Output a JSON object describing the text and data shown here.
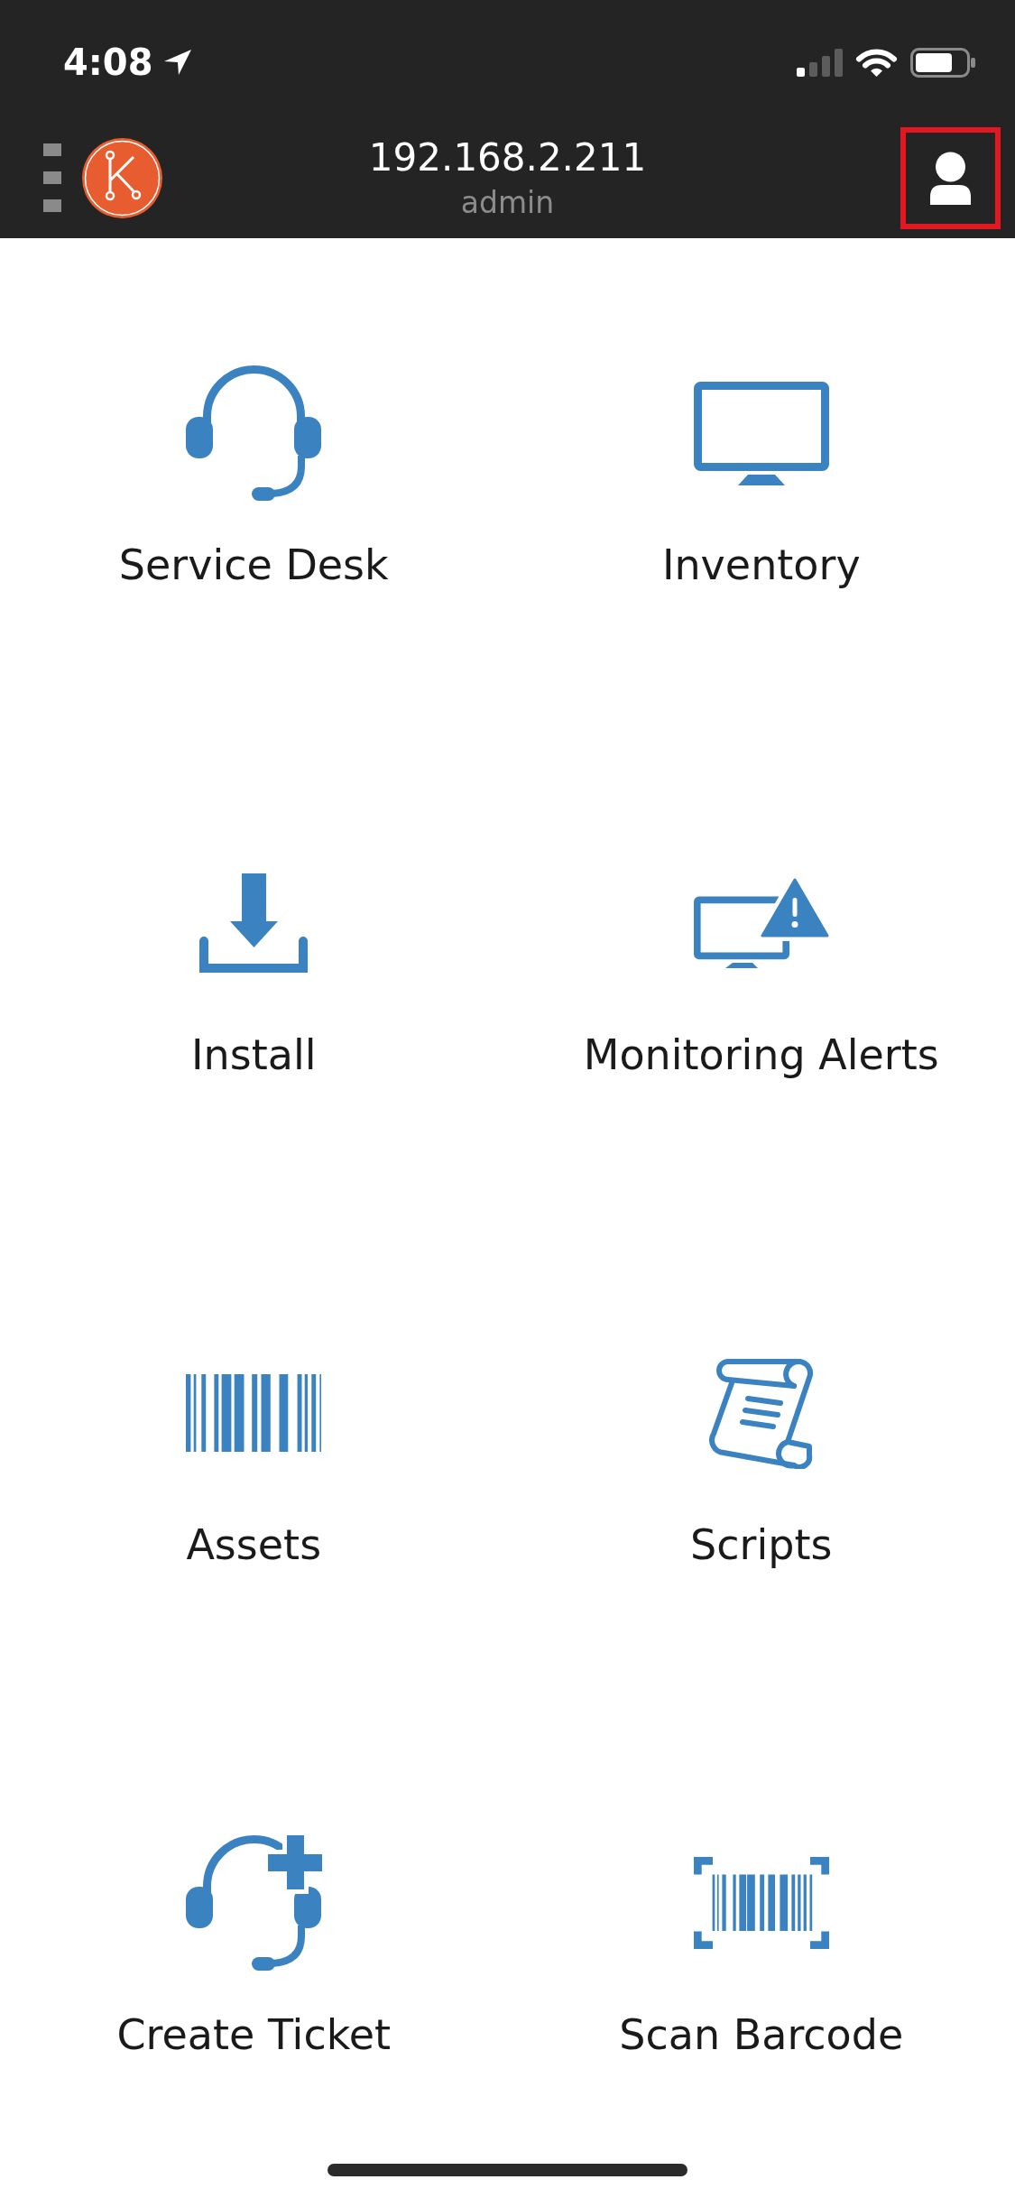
{
  "status_bar": {
    "time": "4:08"
  },
  "header": {
    "title": "192.168.2.211",
    "subtitle": "admin",
    "profile_button": {
      "highlighted": true
    }
  },
  "menu": [
    {
      "label": "Service Desk",
      "kind": "headset"
    },
    {
      "label": "Inventory",
      "kind": "monitor"
    },
    {
      "label": "Install",
      "kind": "download"
    },
    {
      "label": "Monitoring Alerts",
      "kind": "monitor-alert"
    },
    {
      "label": "Assets",
      "kind": "barcode"
    },
    {
      "label": "Scripts",
      "kind": "scroll"
    },
    {
      "label": "Create Ticket",
      "kind": "headset-plus"
    },
    {
      "label": "Scan Barcode",
      "kind": "scan-barcode"
    }
  ]
}
